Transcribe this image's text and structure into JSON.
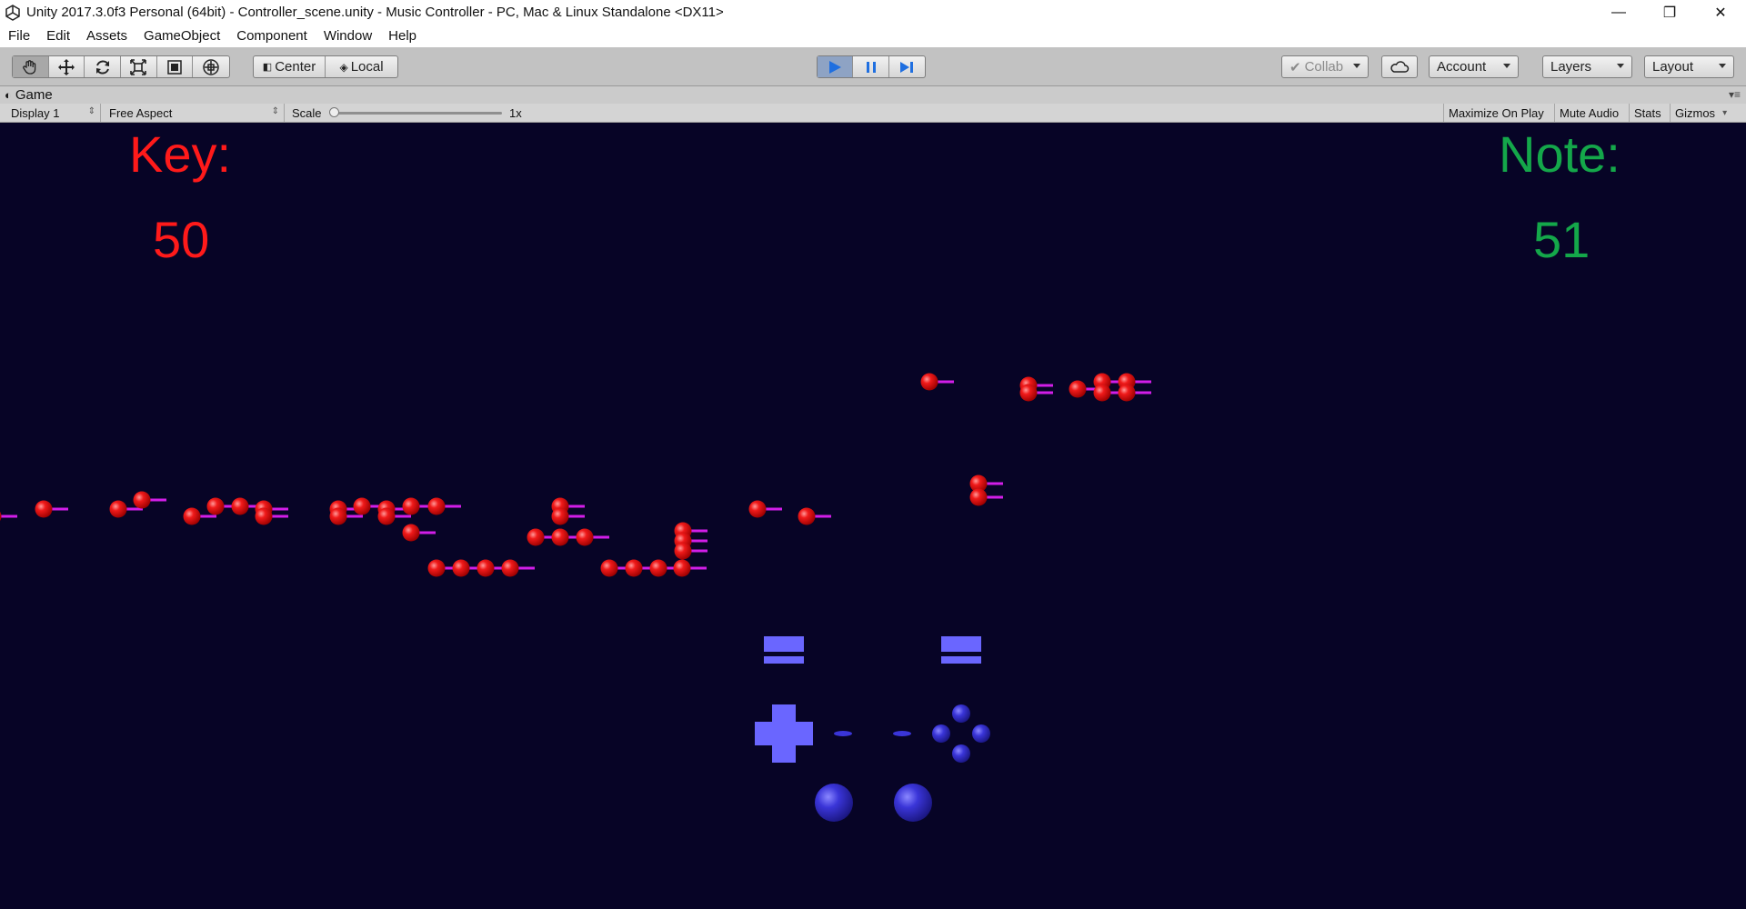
{
  "window": {
    "title": "Unity 2017.3.0f3 Personal (64bit) - Controller_scene.unity - Music Controller - PC, Mac & Linux Standalone <DX11>",
    "controls": [
      "—",
      "❐",
      "✕"
    ]
  },
  "menu": [
    "File",
    "Edit",
    "Assets",
    "GameObject",
    "Component",
    "Window",
    "Help"
  ],
  "toolbar": {
    "pivot_center": "Center",
    "pivot_local": "Local",
    "collab": "Collab",
    "account": "Account",
    "layers": "Layers",
    "layout": "Layout"
  },
  "game_tab": {
    "label": "Game",
    "display": "Display 1",
    "aspect": "Free Aspect",
    "scale_label": "Scale",
    "scale_value": "1x",
    "maximize": "Maximize On Play",
    "mute": "Mute Audio",
    "stats": "Stats",
    "gizmos": "Gizmos"
  },
  "hud": {
    "key_label": "Key:",
    "key_value": "50",
    "note_label": "Note:",
    "note_value": "51",
    "key_color": "#ff1a1a",
    "note_color": "#14a74a"
  },
  "colors": {
    "background": "#070426",
    "note_ball": "#e81212",
    "note_tail": "#d21ee8",
    "controller": "#6a66ff"
  }
}
